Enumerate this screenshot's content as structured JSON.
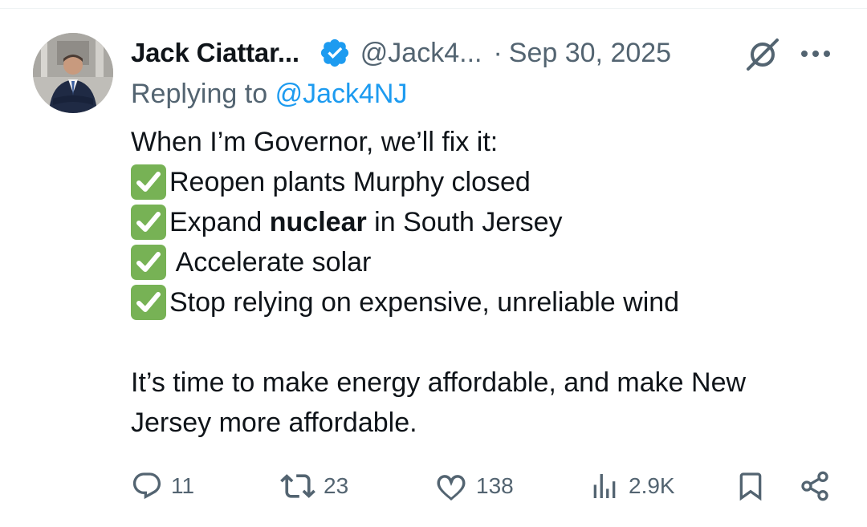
{
  "author": {
    "display_name": "Jack Ciattar...",
    "handle": "@Jack4...",
    "separator": "·",
    "date": "Sep 30, 2025",
    "avatar_icon": "profile-photo",
    "verified_icon": "verified-badge-icon",
    "verified_color": "#1d9bf0"
  },
  "reply": {
    "prefix": "Replying to",
    "mention": "@Jack4NJ"
  },
  "tweet": {
    "intro": "When I’m Governor, we’ll fix it:",
    "items": [
      {
        "icon": "white-check-mark-icon",
        "text": "Reopen plants Murphy closed"
      },
      {
        "icon": "white-check-mark-icon",
        "text_before": "Expand ",
        "text_bold": "nuclear",
        "text_after": " in South Jersey"
      },
      {
        "icon": "white-check-mark-icon",
        "text": " Accelerate solar"
      },
      {
        "icon": "white-check-mark-icon",
        "text": "Stop relying on expensive, unreliable wind"
      }
    ],
    "closing_line_1": "It’s time to make energy affordable, and make New",
    "closing_line_2": "Jersey more affordable."
  },
  "actions": {
    "replies": "11",
    "reposts": "23",
    "likes": "138",
    "views": "2.9K"
  },
  "colors": {
    "text": "#0f1419",
    "muted": "#536471",
    "link": "#1d9bf0",
    "check_bg": "#77b255"
  }
}
